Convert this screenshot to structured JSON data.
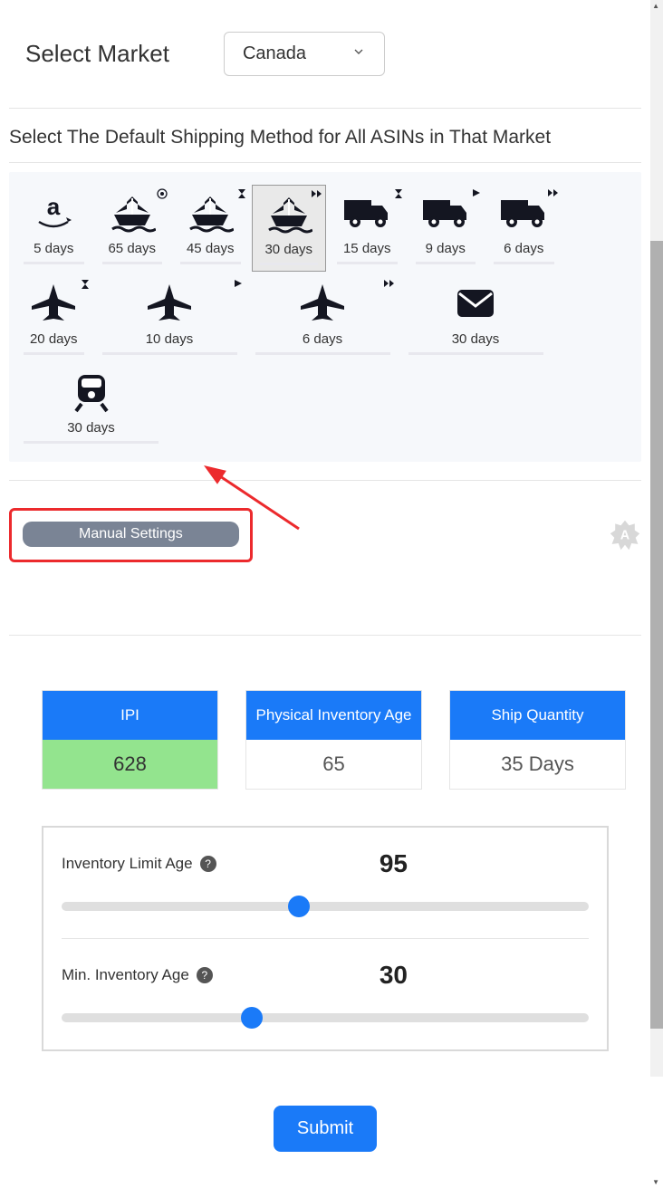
{
  "market": {
    "label": "Select Market",
    "selected": "Canada"
  },
  "shipping": {
    "title": "Select The Default Shipping Method for All ASINs in That Market",
    "options": [
      {
        "icon": "amazon",
        "days": "5 days",
        "badge": null
      },
      {
        "icon": "ship",
        "days": "65 days",
        "badge": "target"
      },
      {
        "icon": "ship",
        "days": "45 days",
        "badge": "hourglass"
      },
      {
        "icon": "ship",
        "days": "30 days",
        "badge": "ff",
        "selected": true
      },
      {
        "icon": "truck",
        "days": "15 days",
        "badge": "hourglass"
      },
      {
        "icon": "truck",
        "days": "9 days",
        "badge": "play"
      },
      {
        "icon": "truck",
        "days": "6 days",
        "badge": "ff"
      },
      {
        "icon": "plane",
        "days": "20 days",
        "badge": "hourglass"
      },
      {
        "icon": "plane",
        "days": "10 days",
        "badge": "play",
        "wide": true
      },
      {
        "icon": "plane",
        "days": "6 days",
        "badge": "ff",
        "wide": true
      },
      {
        "icon": "mail",
        "days": "30 days",
        "badge": null,
        "wide": true
      },
      {
        "icon": "train",
        "days": "30 days",
        "badge": null,
        "wide": true
      }
    ]
  },
  "manual": {
    "button_label": "Manual Settings",
    "auto_label": "A"
  },
  "stats": {
    "ipi": {
      "head": "IPI",
      "value": "628"
    },
    "age": {
      "head": "Physical Inventory Age",
      "value": "65"
    },
    "ship_qty": {
      "head": "Ship Quantity",
      "value": "35 Days"
    }
  },
  "sliders": {
    "limit_age": {
      "label": "Inventory Limit Age",
      "value": "95",
      "percent": 45
    },
    "min_age": {
      "label": "Min. Inventory Age",
      "value": "30",
      "percent": 36
    }
  },
  "submit_label": "Submit"
}
